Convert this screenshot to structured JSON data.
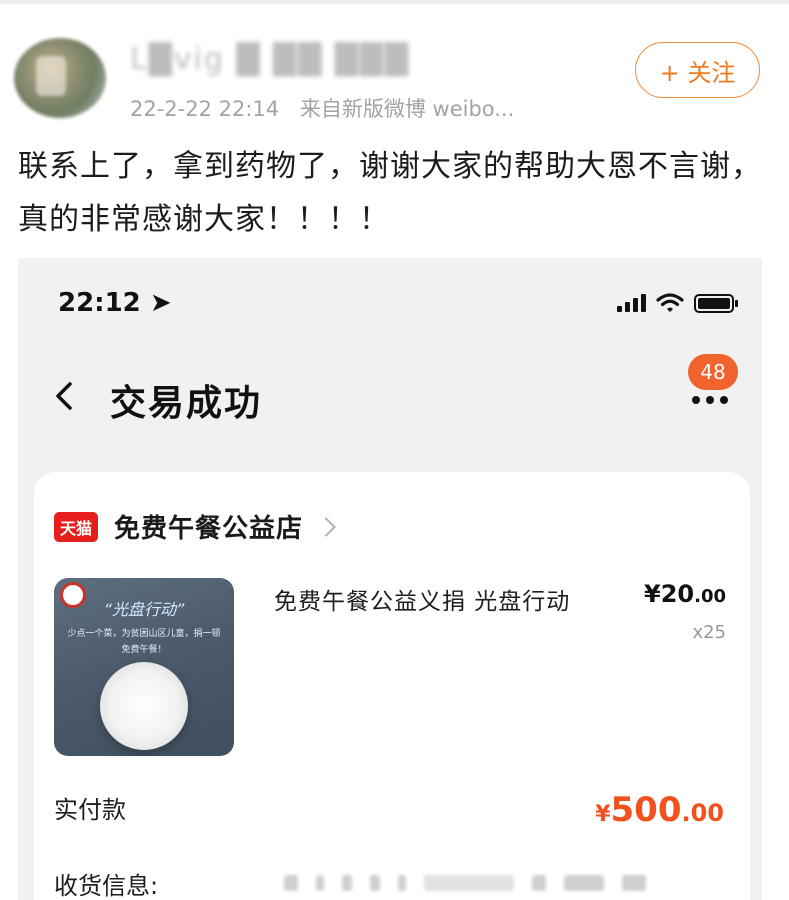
{
  "post": {
    "username": "L█vig █ ██ ███",
    "date": "22-2-22 22:14",
    "source": "来自新版微博 weibo...",
    "follow_label": "+ 关注",
    "text": "联系上了，拿到药物了，谢谢大家的帮助大恩不言谢，真的非常感谢大家！！！！"
  },
  "screenshot": {
    "status_time": "22:12 ➤",
    "nav_title": "交易成功",
    "back_glyph": "‹",
    "badge_count": "48",
    "shop": {
      "logo_text": "天猫",
      "name": "免费午餐公益店"
    },
    "product": {
      "image_title": "“光盘行动”",
      "image_subtitle": "少点一个菜，为贫困山区儿童，捐一顿免费午餐！",
      "name": "免费午餐公益义捐  光盘行动",
      "price_symbol": "¥",
      "price_int": "20",
      "price_cents": ".00",
      "quantity": "x25"
    },
    "paid": {
      "label": "实付款",
      "symbol": "¥",
      "amount_int": "500",
      "amount_cents": ".00"
    },
    "shipping": {
      "label": "收货信息:"
    }
  },
  "colors": {
    "accent_orange": "#ef7a1f",
    "price_red": "#f2511e",
    "tmall_red": "#e5201c",
    "badge": "#f0632d"
  }
}
